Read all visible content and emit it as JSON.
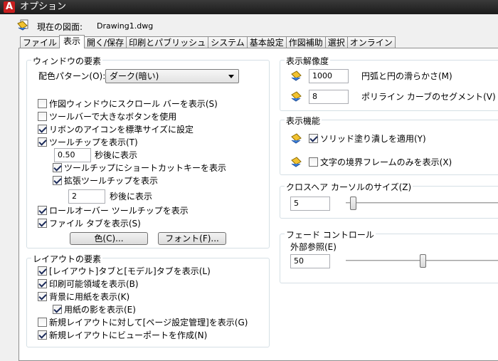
{
  "window": {
    "app_icon": "A",
    "title": "オプション"
  },
  "drawing": {
    "label": "現在の図面:",
    "name": "Drawing1.dwg"
  },
  "tabs": [
    "ファイル",
    "表示",
    "開く/保存",
    "印刷とパブリッシュ",
    "システム",
    "基本設定",
    "作図補助",
    "選択",
    "オンライン"
  ],
  "window_elements": {
    "title": "ウィンドウの要素",
    "color_scheme_label": "配色パターン(O):",
    "color_scheme_value": "ダーク(暗い)",
    "checkboxes": [
      {
        "label": "作図ウィンドウにスクロール バーを表示(S)",
        "checked": false
      },
      {
        "label": "ツールバーで大きなボタンを使用",
        "checked": false
      },
      {
        "label": "リボンのアイコンを標準サイズに設定",
        "checked": true
      },
      {
        "label": "ツールチップを表示(T)",
        "checked": true
      }
    ],
    "tooltip_delay_value": "0.50",
    "tooltip_delay_label": "秒後に表示",
    "shortcut_tooltip": {
      "label": "ツールチップにショートカットキーを表示",
      "checked": true
    },
    "extended_tooltip": {
      "label": "拡張ツールチップを表示",
      "checked": true
    },
    "extended_delay_value": "2",
    "extended_delay_label": "秒後に表示",
    "rollover_tooltip": {
      "label": "ロールオーバー ツールチップを表示",
      "checked": true
    },
    "file_tabs": {
      "label": "ファイル タブを表示(S)",
      "checked": true
    },
    "color_button": "色(C)...",
    "font_button": "フォント(F)..."
  },
  "layout_elements": {
    "title": "レイアウトの要素",
    "checkboxes": [
      {
        "label": "[レイアウト]タブと[モデル]タブを表示(L)",
        "checked": true
      },
      {
        "label": "印刷可能領域を表示(B)",
        "checked": true
      },
      {
        "label": "背景に用紙を表示(K)",
        "checked": true
      },
      {
        "label": "用紙の影を表示(E)",
        "checked": true
      },
      {
        "label": "新規レイアウトに対して[ページ設定管理]を表示(G)",
        "checked": false
      },
      {
        "label": "新規レイアウトにビューポートを作成(N)",
        "checked": true
      }
    ]
  },
  "resolution": {
    "title": "表示解像度",
    "items": [
      {
        "value": "1000",
        "label": "円弧と円の滑らかさ(M)"
      },
      {
        "value": "8",
        "label": "ポリライン カーブのセグメント(V)"
      }
    ]
  },
  "performance": {
    "title": "表示機能",
    "items": [
      {
        "label": "ソリッド塗り潰しを適用(Y)",
        "checked": true
      },
      {
        "label": "文字の境界フレームのみを表示(X)",
        "checked": false
      }
    ]
  },
  "crosshair": {
    "title": "クロスヘア カーソルのサイズ(Z)",
    "value": "5",
    "slider_fraction": 0.05
  },
  "fade": {
    "title": "フェード コントロール",
    "xref_label": "外部参照(E)",
    "xref_value": "50",
    "slider_fraction": 0.5
  }
}
